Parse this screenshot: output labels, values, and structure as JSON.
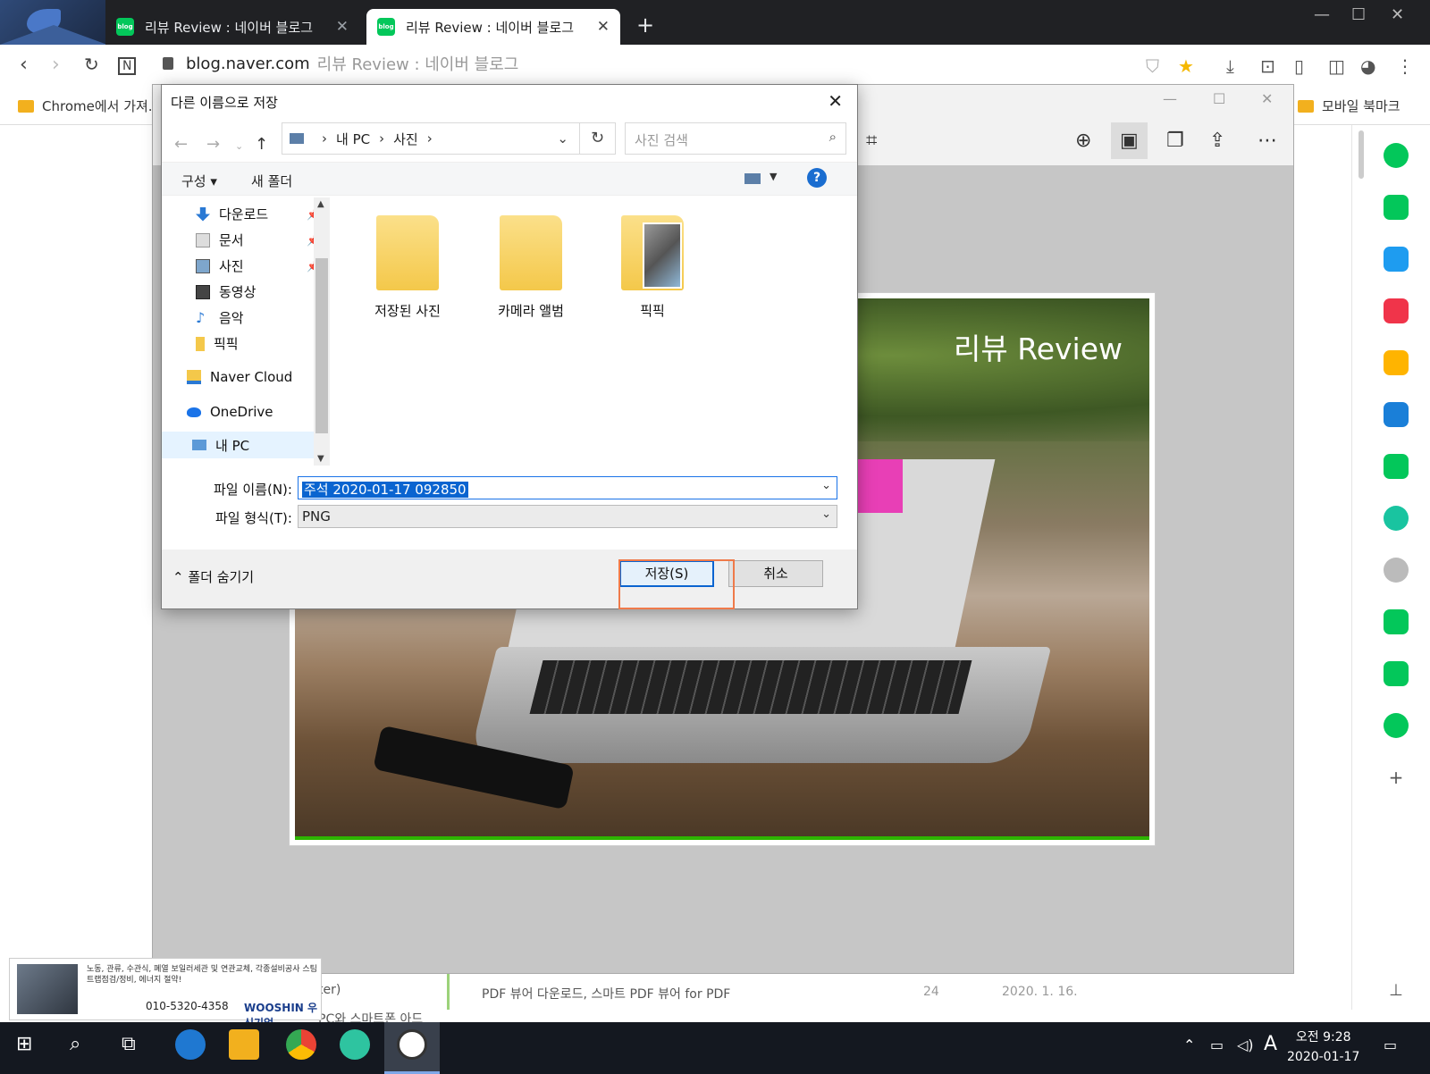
{
  "browser": {
    "tabs": [
      {
        "label": "리뷰 Review : 네이버 블로그",
        "active": false
      },
      {
        "label": "리뷰 Review : 네이버 블로그",
        "active": true
      }
    ],
    "tab_favicon_text": "blog",
    "new_tab": "+",
    "url_domain": "blog.naver.com",
    "url_title": "리뷰 Review : 네이버 블로그",
    "bookmarks": {
      "left": "Chrome에서 가져...",
      "right": "모바일 북마크"
    },
    "window_controls": [
      "—",
      "☐",
      "✕"
    ]
  },
  "viewer": {
    "photo_title": "리뷰 Review",
    "window_controls": [
      "—",
      "☐",
      "✕"
    ]
  },
  "dialog": {
    "title": "다른 이름으로 저장",
    "close": "✕",
    "address": {
      "segments": [
        "내 PC",
        "사진"
      ]
    },
    "search_placeholder": "사진 검색",
    "commands": {
      "organize": "구성 ▾",
      "new_folder": "새 폴더",
      "help": "?"
    },
    "tree": [
      {
        "label": "다운로드",
        "pinned": true
      },
      {
        "label": "문서",
        "pinned": true
      },
      {
        "label": "사진",
        "pinned": true
      },
      {
        "label": "동영상",
        "pinned": false
      },
      {
        "label": "음악",
        "pinned": false
      },
      {
        "label": "픽픽",
        "pinned": false
      },
      {
        "label": "Naver Cloud",
        "pinned": false
      },
      {
        "label": "OneDrive",
        "pinned": false
      },
      {
        "label": "내 PC",
        "pinned": false,
        "selected": true
      }
    ],
    "folders": [
      {
        "label": "저장된 사진"
      },
      {
        "label": "카메라 앨범"
      },
      {
        "label": "픽픽"
      }
    ],
    "filename_label": "파일 이름(N):",
    "filename_value": "주석 2020-01-17 092850",
    "filetype_label": "파일 형식(T):",
    "filetype_value": "PNG",
    "hide_folders": "폴더 숨기기",
    "save_button": "저장(S)",
    "cancel_button": "취소"
  },
  "page_behind": {
    "list_rows": [
      {
        "title": "PDF 뷰어 다운로드, 스마트 PDF 뷰어 for PDF",
        "count": "24",
        "date": "2020. 1. 16."
      }
    ],
    "partial_texts": [
      "ter)",
      "PC와 스마트폰 아드"
    ],
    "ad": {
      "text": "노동, 관류, 수관식, 폐열 보일러세관 및 연관교체, 각종설비공사 스팀트랩점검/정비, 에너지 절약!",
      "phone": "010-5320-4358",
      "brand": "WOOSHIN 우신기업"
    }
  },
  "taskbar": {
    "time": "오전 9:28",
    "date": "2020-01-17",
    "ime": "A"
  },
  "colors": {
    "accent": "#0a64d0",
    "naver_green": "#03c75a",
    "highlight_box": "#ef7a4a",
    "arrow": "#e05a3a"
  }
}
